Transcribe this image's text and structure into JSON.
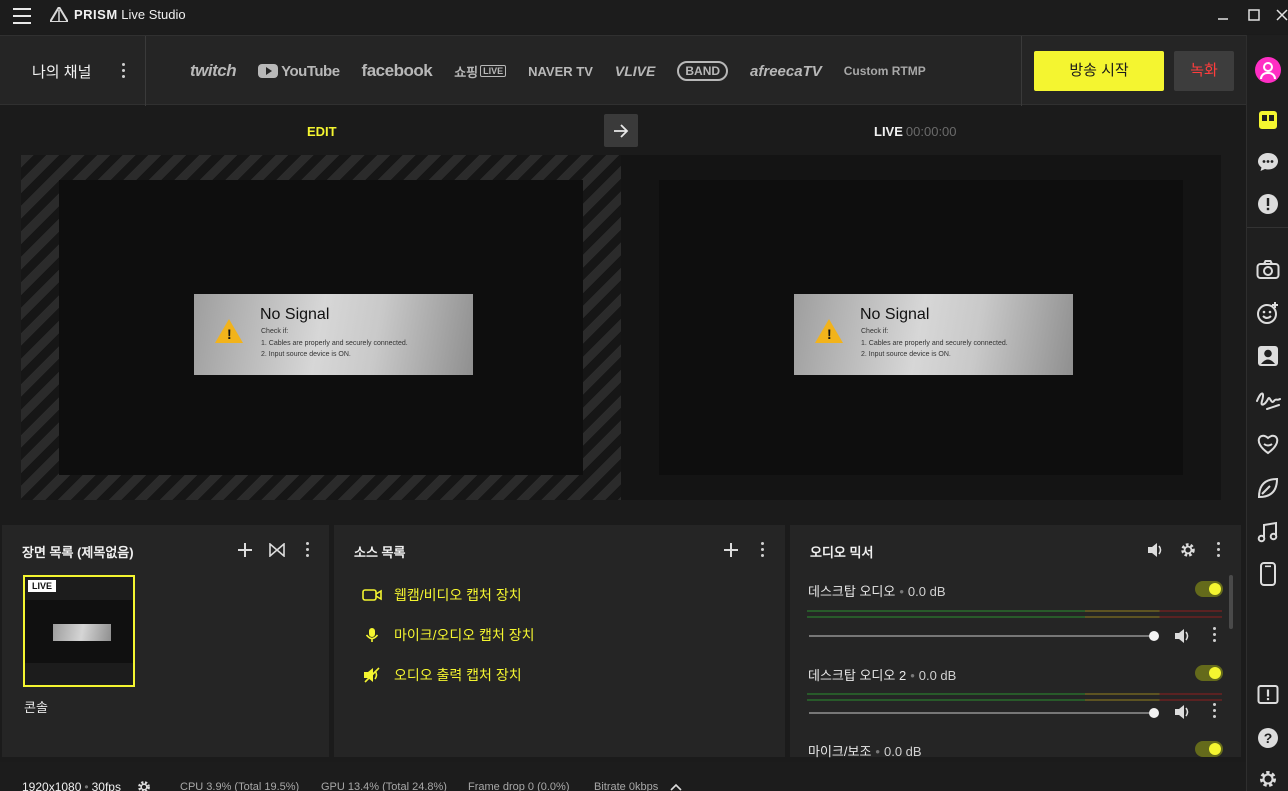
{
  "app": {
    "title_bold": "PRISM",
    "title_rest": " Live Studio"
  },
  "channel": {
    "my_channel_label": "나의 채널",
    "platforms": [
      "twitch",
      "YouTube",
      "facebook",
      "쇼핑",
      "LIVE",
      "NAVER TV",
      "VLIVE",
      "BAND",
      "afreecaTV",
      "Custom RTMP"
    ],
    "broadcast_button": "방송 시작",
    "record_button": "녹화"
  },
  "preview": {
    "edit_tab": "EDIT",
    "live_tab": "LIVE",
    "live_time": "00:00:00",
    "no_signal": {
      "title": "No Signal",
      "line1": "Check if:",
      "line2": "1. Cables are properly and securely connected.",
      "line3": "2. Input source device is ON."
    }
  },
  "scenes": {
    "title": "장면 목록  (제목없음)",
    "live_badge": "LIVE",
    "items": [
      {
        "label": "콘솔"
      }
    ]
  },
  "sources": {
    "title": "소스 목록",
    "items": [
      {
        "label": "웹캠/비디오 캡처 장치",
        "icon": "camera-icon"
      },
      {
        "label": "마이크/오디오 캡처 장치",
        "icon": "microphone-icon"
      },
      {
        "label": "오디오 출력 캡처 장치",
        "icon": "speaker-icon"
      }
    ]
  },
  "mixer": {
    "title": "오디오 믹서",
    "channels": [
      {
        "name": "데스크탑 오디오",
        "db": "0.0 dB"
      },
      {
        "name": "데스크탑 오디오 2",
        "db": "0.0 dB"
      },
      {
        "name": "마이크/보조",
        "db": "0.0 dB"
      }
    ]
  },
  "status": {
    "resolution": "1920x1080",
    "fps": "30fps",
    "cpu": "CPU 3.9% (Total 19.5%)",
    "gpu": "GPU 13.4% (Total 24.8%)",
    "frame_drop": "Frame drop 0 (0.0%)",
    "bitrate": "Bitrate 0kbps"
  },
  "colors": {
    "accent": "#f4f530",
    "record": "#ff3d3d",
    "profile": "#ff2ec4"
  }
}
